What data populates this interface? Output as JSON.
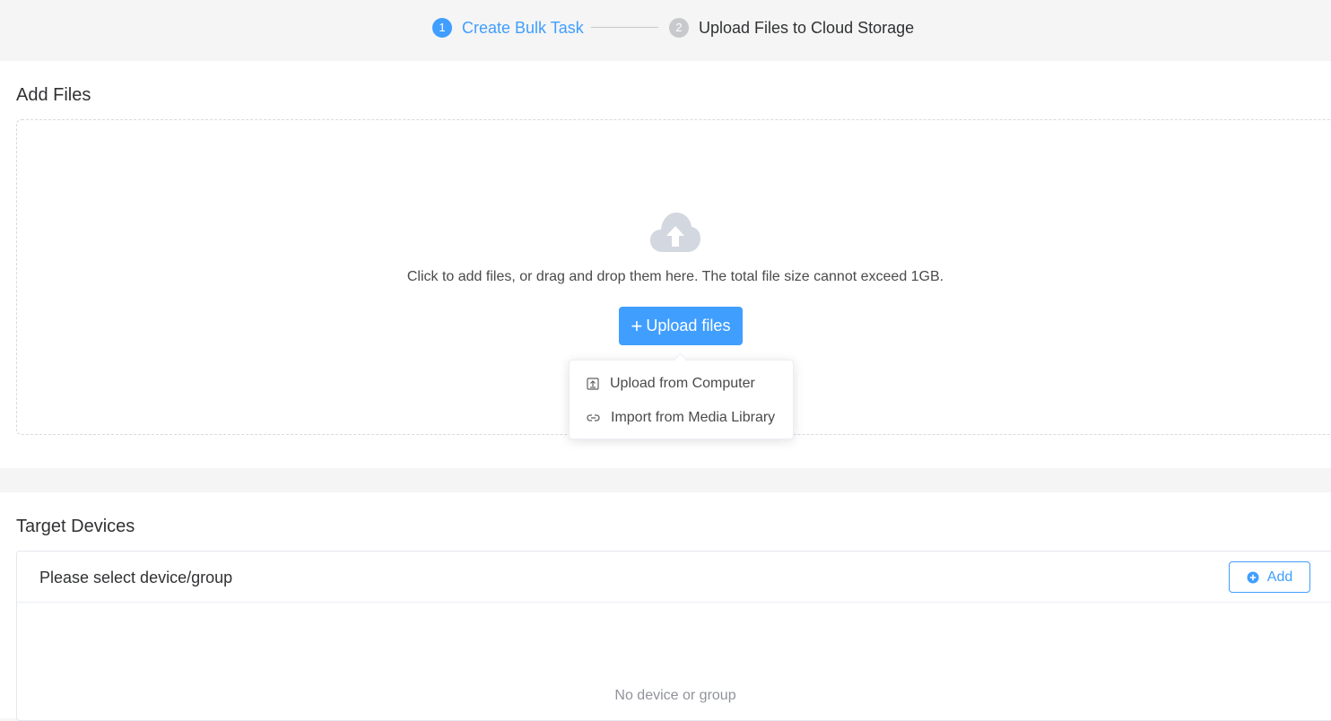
{
  "stepper": {
    "steps": [
      {
        "number": "1",
        "label": "Create Bulk Task",
        "state": "active"
      },
      {
        "number": "2",
        "label": "Upload Files to Cloud Storage",
        "state": "pending"
      }
    ]
  },
  "add_files": {
    "title": "Add Files",
    "hint": "Click to add files, or drag and drop them here. The total file size cannot exceed 1GB.",
    "upload_button_label": "Upload files",
    "upload_button_icon": "plus-icon",
    "cloud_icon": "cloud-upload-icon",
    "menu": [
      {
        "label": "Upload from Computer",
        "icon": "upload-box-icon"
      },
      {
        "label": "Import from Media Library",
        "icon": "link-icon"
      }
    ]
  },
  "target_devices": {
    "title": "Target Devices",
    "header_label": "Please select device/group",
    "add_button_label": "Add",
    "add_button_icon": "plus-circle-icon",
    "empty_text": "No device or group"
  },
  "colors": {
    "accent": "#409eff",
    "pending_step": "#c8c9cc",
    "cloud_icon": "#d3d7e0",
    "page_background": "#f5f5f5"
  }
}
